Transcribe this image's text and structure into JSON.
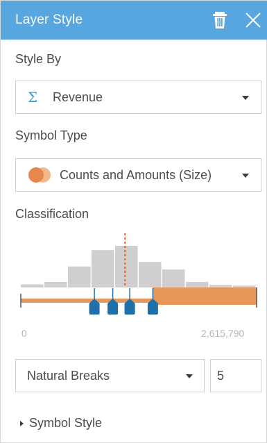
{
  "header": {
    "title": "Layer Style",
    "bg_color": "#57a6e0",
    "icons": [
      "trash-icon",
      "close-icon"
    ]
  },
  "style_by": {
    "label": "Style By",
    "icon": "sigma-icon",
    "value": "Revenue"
  },
  "symbol_type": {
    "label": "Symbol Type",
    "icon": "proportional-circles-icon",
    "value": "Counts and Amounts (Size)"
  },
  "classification": {
    "label": "Classification",
    "range_min": "0",
    "range_max": "2,615,790",
    "bar_heights": [
      0.06,
      0.105,
      0.398,
      0.708,
      0.789,
      0.483,
      0.34,
      0.106,
      0.048,
      0.034
    ],
    "mean_fraction": 0.442,
    "break_fractions": [
      0.312,
      0.39,
      0.462,
      0.56
    ],
    "histogram_color": "#cfcfcf",
    "size_band_color": "#e8965a",
    "handle_color": "#1f6fa8",
    "mean_line_color": "#e0602d"
  },
  "method": {
    "value": "Natural Breaks",
    "count": "5"
  },
  "symbol_style": {
    "label": "Symbol Style"
  }
}
